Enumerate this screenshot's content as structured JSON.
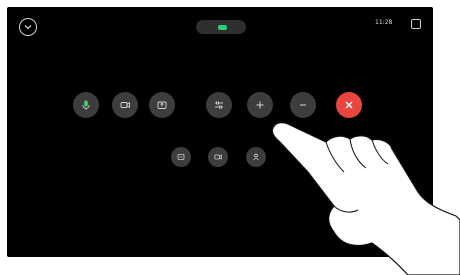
{
  "status_bar": {
    "pill_text": "",
    "time": "11:28"
  },
  "call_controls": [
    {
      "name": "mic-button",
      "icon": "microphone-icon",
      "label": "",
      "variant": "normal"
    },
    {
      "name": "camera-button",
      "icon": "camera-icon",
      "label": "",
      "variant": "normal"
    },
    {
      "name": "share-button",
      "icon": "share-screen-icon",
      "label": "",
      "variant": "normal"
    },
    {
      "name": "layout-button",
      "icon": "sliders-icon",
      "label": "",
      "variant": "normal"
    },
    {
      "name": "add-button",
      "icon": "plus-icon",
      "label": "",
      "variant": "normal"
    },
    {
      "name": "hold-button",
      "icon": "minus-icon",
      "label": "",
      "variant": "normal"
    },
    {
      "name": "end-call-button",
      "icon": "close-icon",
      "label": "",
      "variant": "red"
    }
  ],
  "secondary_controls": [
    {
      "name": "keypad-button",
      "icon": "keypad-icon",
      "label": ""
    },
    {
      "name": "record-button",
      "icon": "record-icon",
      "label": ""
    },
    {
      "name": "participants-button",
      "icon": "participants-icon",
      "label": ""
    }
  ],
  "colors": {
    "screen_background": "#000000",
    "control_background": "#3d3d3d",
    "end_call": "#e8473f",
    "status_green": "#2ecc71"
  }
}
